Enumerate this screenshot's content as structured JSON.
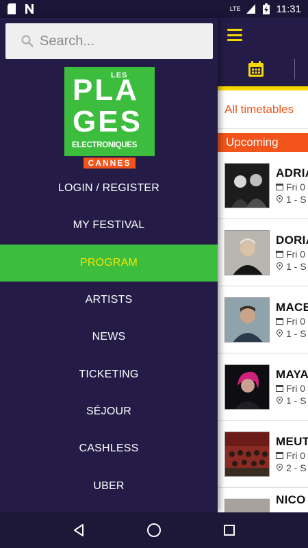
{
  "status_bar": {
    "network": "LTE",
    "time": "11:31",
    "icons": [
      "sd-card-icon",
      "nfc-n-icon",
      "signal-icon",
      "battery-charging-icon"
    ]
  },
  "drawer": {
    "search": {
      "placeholder": "Search..."
    },
    "logo": {
      "line1": "LES",
      "line2": "PLA",
      "line3": "GES",
      "line4": "ELECTRONIQUES",
      "line5": "CANNES"
    },
    "menu": [
      {
        "label": "LOGIN / REGISTER",
        "active": false
      },
      {
        "label": "MY FESTIVAL",
        "active": false
      },
      {
        "label": "PROGRAM",
        "active": true
      },
      {
        "label": "ARTISTS",
        "active": false
      },
      {
        "label": "NEWS",
        "active": false
      },
      {
        "label": "TICKETING",
        "active": false
      },
      {
        "label": "SÉJOUR",
        "active": false
      },
      {
        "label": "CASHLESS",
        "active": false
      },
      {
        "label": "UBER",
        "active": false
      }
    ]
  },
  "app": {
    "all_timetables": "All timetables",
    "section": "Upcoming",
    "events": [
      {
        "name": "ADRIA",
        "day": "Fri 0",
        "stage": "1 - S"
      },
      {
        "name": "DORIA",
        "day": "Fri 0",
        "stage": "1 - S"
      },
      {
        "name": "MACE",
        "day": "Fri 0",
        "stage": "1 - S"
      },
      {
        "name": "MAYA",
        "day": "Fri 0",
        "stage": "1 - S"
      },
      {
        "name": "MEUT",
        "day": "Fri 0",
        "stage": "2 - S"
      },
      {
        "name": "NICO",
        "day": "",
        "stage": ""
      }
    ]
  },
  "colors": {
    "brand_purple": "#241c47",
    "accent_green": "#3dbd3e",
    "accent_yellow": "#f5d800",
    "accent_orange": "#f2541b"
  }
}
